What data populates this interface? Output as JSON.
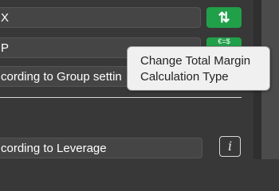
{
  "fields": {
    "field1_value": "X",
    "field2_value": "P",
    "margin_type_value": "cording to Group settin",
    "leverage_value": "cording to Leverage"
  },
  "buttons": {
    "swap_icon_glyph": "⇅",
    "currency_glyph": "€=$"
  },
  "tooltip": {
    "line1": "Change Total Margin",
    "line2": "Calculation Type"
  },
  "info_button": {
    "glyph": "i"
  },
  "colors": {
    "accent_green": "#21a04a",
    "panel_bg": "#383838",
    "field_bg": "#454545",
    "tooltip_bg": "#f0f0f0"
  },
  "icons": [
    "swap-vertical-icon",
    "currency-exchange-icon",
    "info-icon"
  ]
}
